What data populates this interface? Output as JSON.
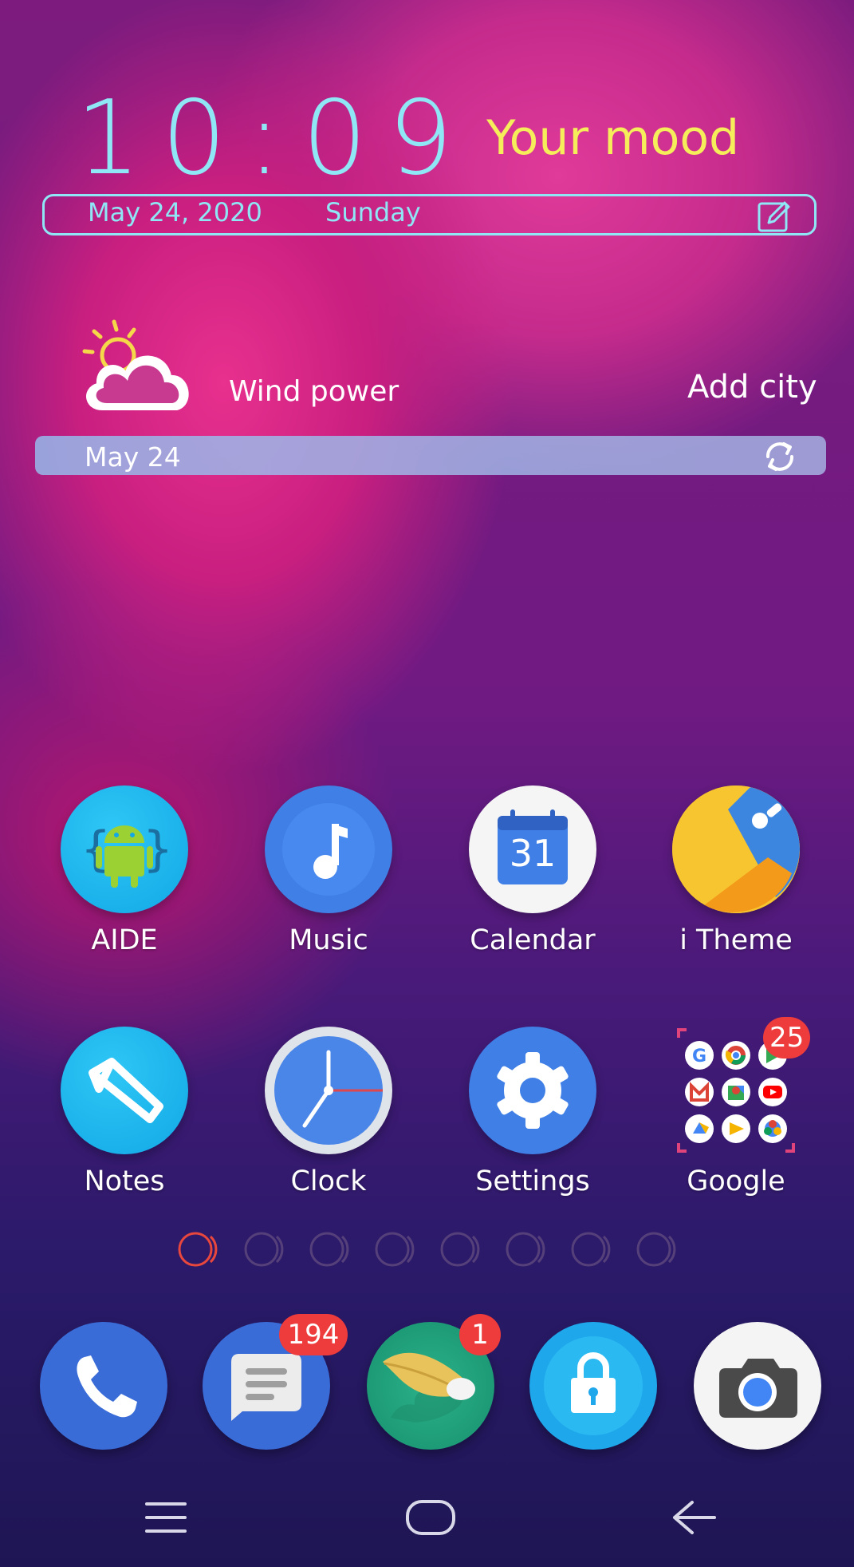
{
  "clock_widget": {
    "time": "10:09",
    "mood": "Your mood",
    "date": "May 24, 2020",
    "day": "Sunday",
    "edit_icon": "edit-icon"
  },
  "weather_widget": {
    "condition_icon": "partly-cloudy-icon",
    "wind": "Wind power",
    "add_city": "Add city",
    "date": "May 24",
    "refresh_icon": "refresh-icon"
  },
  "apps": [
    {
      "label": "AIDE",
      "icon": "android-icon"
    },
    {
      "label": "Music",
      "icon": "music-note-icon"
    },
    {
      "label": "Calendar",
      "icon": "calendar-icon",
      "calendar_day": "31"
    },
    {
      "label": "i Theme",
      "icon": "theme-icon"
    },
    {
      "label": "Notes",
      "icon": "notes-icon"
    },
    {
      "label": "Clock",
      "icon": "clock-icon"
    },
    {
      "label": "Settings",
      "icon": "gear-icon"
    },
    {
      "label": "Google",
      "icon": "folder-icon",
      "badge": "25"
    }
  ],
  "page_indicator": {
    "pages": 8,
    "current": 1
  },
  "dock": [
    {
      "name": "phone",
      "icon": "phone-icon"
    },
    {
      "name": "messages",
      "icon": "message-icon",
      "badge": "194"
    },
    {
      "name": "feather",
      "icon": "feather-icon",
      "badge": "1"
    },
    {
      "name": "app-lock",
      "icon": "lock-icon"
    },
    {
      "name": "camera",
      "icon": "camera-icon"
    }
  ],
  "navbar": {
    "menu": "menu-icon",
    "home": "home-icon",
    "back": "back-icon"
  },
  "colors": {
    "clock_cyan": "#8fe6f5",
    "mood_yellow": "#f5ee5a",
    "badge_red": "#ee3b3b"
  }
}
